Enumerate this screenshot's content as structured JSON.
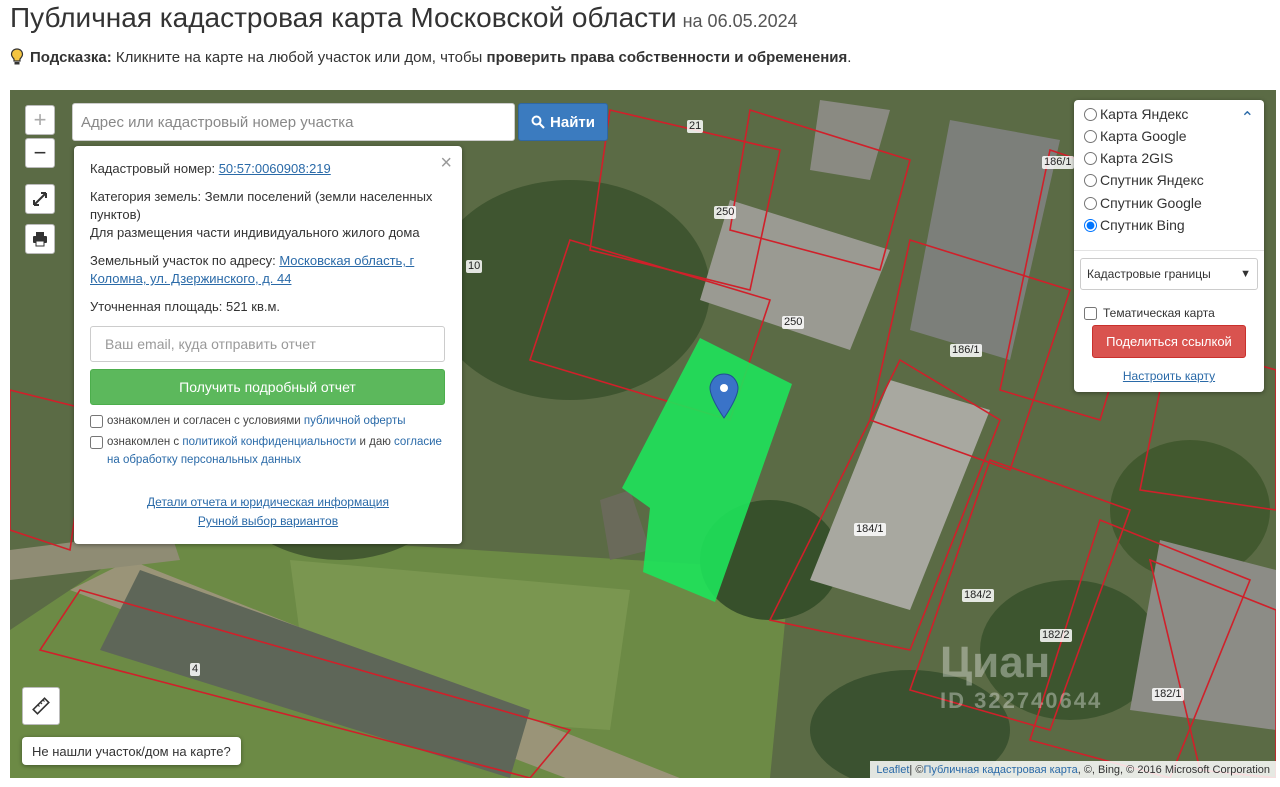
{
  "header": {
    "title": "Публичная кадастровая карта Московской области",
    "date": "на 06.05.2024"
  },
  "hint": {
    "label": "Подсказка:",
    "text": "Кликните на карте на любой участок или дом, чтобы",
    "bold": "проверить права собственности и обременения",
    "end": "."
  },
  "search": {
    "placeholder": "Адрес или кадастровый номер участка",
    "button": "Найти"
  },
  "zoom": {
    "in": "+",
    "out": "−"
  },
  "popup": {
    "cad_label": "Кадастровый номер:",
    "cad_value": "50:57:0060908:219",
    "category_label": "Категория земель:",
    "category_value": "Земли поселений (земли населенных пунктов)",
    "usage": "Для размещения части индивидуального жилого дома",
    "address_label": "Земельный участок по адресу:",
    "address_value": "Московская область, г Коломна, ул. Дзержинского, д. 44",
    "area_label": "Уточненная площадь:",
    "area_value": "521 кв.м.",
    "email_placeholder": "Ваш email, куда отправить отчет",
    "report_button": "Получить подробный отчет",
    "agree1_text": "ознакомлен и согласен с условиями",
    "agree1_link": "публичной оферты",
    "agree2_text": "ознакомлен с",
    "agree2_link": "политикой конфиденциальности",
    "agree2_mid": "и даю",
    "agree2_link2": "согласие на обработку персональных данных",
    "link_details": "Детали отчета и юридическая информация",
    "link_manual": "Ручной выбор вариантов",
    "close": "×"
  },
  "layers": {
    "options": [
      "Карта Яндекс",
      "Карта Google",
      "Карта 2GIS",
      "Спутник Яндекс",
      "Спутник Google",
      "Спутник Bing"
    ],
    "selected_index": 5,
    "select_value": "Кадастровые границы",
    "thematic": "Тематическая карта",
    "share_button": "Поделиться ссылкой",
    "custom_link": "Настроить карту"
  },
  "not_found": "Не нашли участок/дом на карте?",
  "attribution": {
    "leaflet": "Leaflet",
    "sep1": " | © ",
    "source": "Публичная кадастровая карта",
    "rest": ", ©, Bing, © 2016 Microsoft Corporation"
  },
  "plot_labels": [
    "21",
    "186/1",
    "250",
    "10",
    "250",
    "186/1",
    "184/1",
    "184/2",
    "182/2",
    "182/1",
    "4"
  ],
  "watermark": {
    "brand": "Циан",
    "id": "ID 322740644"
  },
  "colors": {
    "accent": "#3b7bbf",
    "success": "#5cb85c",
    "danger": "#d9534f",
    "parcel": "#1ee35a",
    "boundary": "#d0202a"
  }
}
